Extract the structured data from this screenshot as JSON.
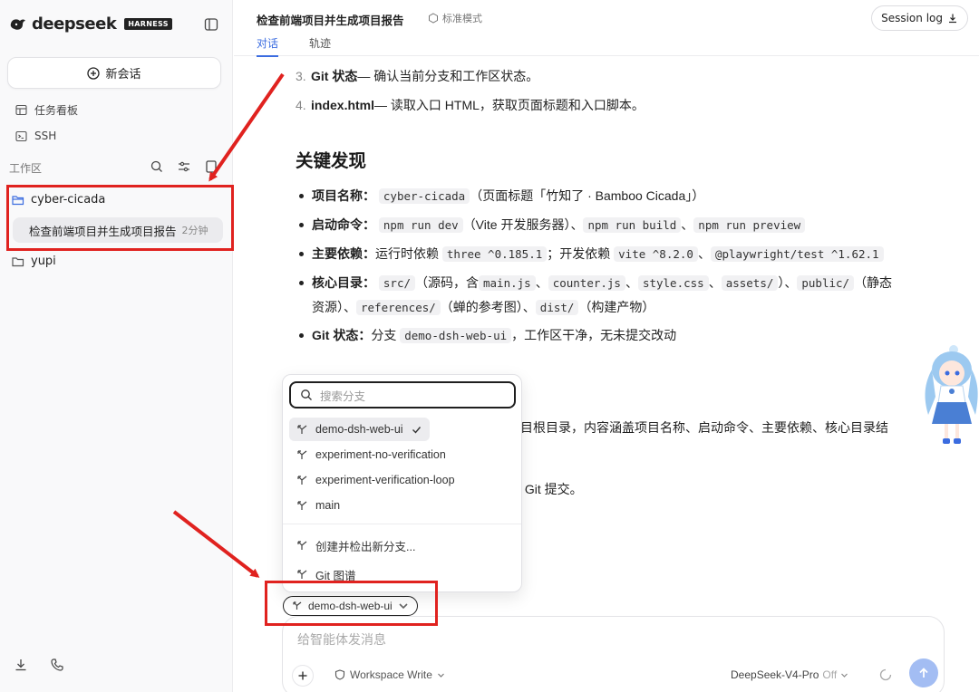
{
  "sidebar": {
    "brand": "deepseek",
    "badge": "HARNESS",
    "new_chat": "新会话",
    "nav": [
      {
        "label": "任务看板",
        "icon": "kanban-icon"
      },
      {
        "label": "SSH",
        "icon": "terminal-icon"
      }
    ],
    "workspace_label": "工作区",
    "folders": [
      {
        "name": "cyber-cicada",
        "icon": "folder-open-icon",
        "color": "#3b6ce0"
      },
      {
        "name": "yupi",
        "icon": "folder-icon",
        "color": "#555555"
      }
    ],
    "session": {
      "title": "检查前端项目并生成项目报告",
      "age": "2分钟"
    }
  },
  "header": {
    "title": "检查前端项目并生成项目报告",
    "mode": "标准模式",
    "tabs": [
      "对话",
      "轨迹"
    ],
    "session_log": "Session log"
  },
  "content": {
    "ol": [
      {
        "num": "3.",
        "bold": "Git 状态",
        "text": " — 确认当前分支和工作区状态。"
      },
      {
        "num": "4.",
        "bold": "index.html",
        "text": " — 读取入口 HTML，获取页面标题和入口脚本。"
      }
    ],
    "heading": "关键发现",
    "bullets": {
      "b1": {
        "label": "项目名称：",
        "c1": "cyber-cicada",
        "t1": "（页面标题「竹知了 · Bamboo Cicada」）"
      },
      "b2": {
        "label": "启动命令：",
        "c1": "npm run dev",
        "t1": "（Vite 开发服务器）、",
        "c2": "npm run build",
        "t2": "、",
        "c3": "npm run preview"
      },
      "b3": {
        "label": "主要依赖：",
        "t0": "运行时依赖",
        "c1": "three ^0.185.1",
        "t1": "；开发依赖",
        "c2": "vite ^8.2.0",
        "t2": "、",
        "c3": "@playwright/test ^1.62.1"
      },
      "b4": {
        "label": "核心目录：",
        "c1": "src/",
        "t1": "（源码，含",
        "c2": "main.js",
        "t2": "、",
        "c3": "counter.js",
        "t3": "、",
        "c4": "style.css",
        "t4": "、",
        "c5": "assets/",
        "t5": "）、",
        "c6": "public/",
        "t6": "（静态",
        "t7": "资源）、",
        "c7": "references/",
        "t8": "（蝉的参考图）、",
        "c8": "dist/",
        "t9": "（构建产物）"
      },
      "b5": {
        "label": "Git 状态：",
        "t0": "分支",
        "c1": "demo-dsh-web-ui",
        "t1": "，工作区干净，无未提交改动"
      }
    },
    "frag1": "目根目录，内容涵盖项目名称、启动命令、主要依赖、核心目录结",
    "frag2": "行 Git 提交。"
  },
  "branch_menu": {
    "search_placeholder": "搜索分支",
    "branches": [
      "demo-dsh-web-ui",
      "experiment-no-verification",
      "experiment-verification-loop",
      "main"
    ],
    "selected": "demo-dsh-web-ui",
    "actions": [
      "创建并检出新分支...",
      "Git 图谱"
    ]
  },
  "branch_pill": "demo-dsh-web-ui",
  "composer": {
    "placeholder": "给智能体发消息",
    "workspace_mode": "Workspace Write",
    "model": "DeepSeek-V4-Pro",
    "thinking": "Off"
  },
  "colors": {
    "accent": "#3b6ce0",
    "annotation": "#e0221f",
    "send": "#a3bdf3"
  }
}
